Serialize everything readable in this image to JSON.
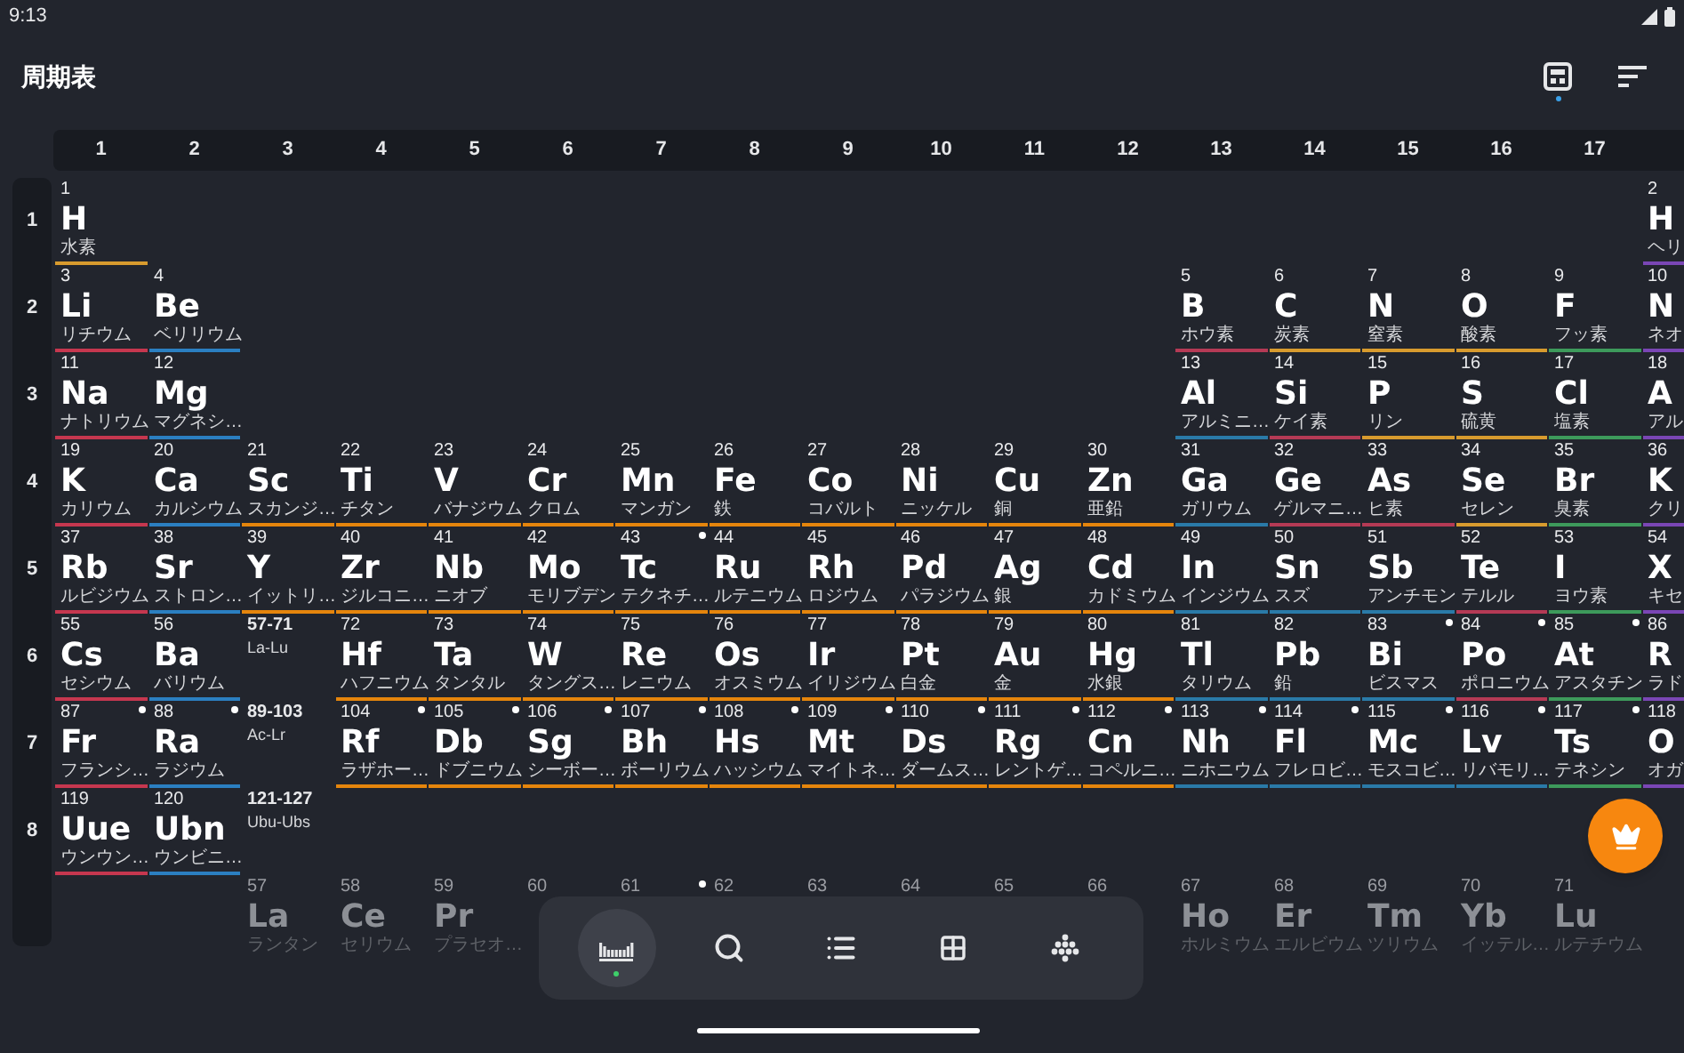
{
  "status_bar": {
    "time": "9:13"
  },
  "app_bar": {
    "title": "周期表",
    "actions": [
      {
        "badge": true
      },
      {
        "badge": false
      }
    ]
  },
  "group_header": [
    "1",
    "2",
    "3",
    "4",
    "5",
    "6",
    "7",
    "8",
    "9",
    "10",
    "11",
    "12",
    "13",
    "14",
    "15",
    "16",
    "17"
  ],
  "periods": [
    {
      "label": "1",
      "cells": [
        {
          "kind": "element",
          "number": "1",
          "symbol": "H",
          "name": "水素",
          "color": "#d89b2e",
          "radioactive": false
        },
        {
          "kind": "empty"
        },
        {
          "kind": "empty"
        },
        {
          "kind": "empty"
        },
        {
          "kind": "empty"
        },
        {
          "kind": "empty"
        },
        {
          "kind": "empty"
        },
        {
          "kind": "empty"
        },
        {
          "kind": "empty"
        },
        {
          "kind": "empty"
        },
        {
          "kind": "empty"
        },
        {
          "kind": "empty"
        },
        {
          "kind": "empty"
        },
        {
          "kind": "empty"
        },
        {
          "kind": "empty"
        },
        {
          "kind": "empty"
        },
        {
          "kind": "empty"
        },
        {
          "kind": "element",
          "number": "2",
          "symbol": "H",
          "name": "ヘリ",
          "color": "#7a46b5",
          "radioactive": false
        }
      ]
    },
    {
      "label": "2",
      "cells": [
        {
          "kind": "element",
          "number": "3",
          "symbol": "Li",
          "name": "リチウム",
          "color": "#c6374f",
          "radioactive": false
        },
        {
          "kind": "element",
          "number": "4",
          "symbol": "Be",
          "name": "ベリリウム",
          "color": "#2b7fc1",
          "radioactive": false
        },
        {
          "kind": "empty"
        },
        {
          "kind": "empty"
        },
        {
          "kind": "empty"
        },
        {
          "kind": "empty"
        },
        {
          "kind": "empty"
        },
        {
          "kind": "empty"
        },
        {
          "kind": "empty"
        },
        {
          "kind": "empty"
        },
        {
          "kind": "empty"
        },
        {
          "kind": "empty"
        },
        {
          "kind": "element",
          "number": "5",
          "symbol": "B",
          "name": "ホウ素",
          "color": "#b53a55",
          "radioactive": false
        },
        {
          "kind": "element",
          "number": "6",
          "symbol": "C",
          "name": "炭素",
          "color": "#d89b2e",
          "radioactive": false
        },
        {
          "kind": "element",
          "number": "7",
          "symbol": "N",
          "name": "窒素",
          "color": "#d89b2e",
          "radioactive": false
        },
        {
          "kind": "element",
          "number": "8",
          "symbol": "O",
          "name": "酸素",
          "color": "#d89b2e",
          "radioactive": false
        },
        {
          "kind": "element",
          "number": "9",
          "symbol": "F",
          "name": "フッ素",
          "color": "#3d9a5b",
          "radioactive": false
        },
        {
          "kind": "element",
          "number": "10",
          "symbol": "N",
          "name": "ネオ",
          "color": "#7a46b5",
          "radioactive": false
        }
      ]
    },
    {
      "label": "3",
      "cells": [
        {
          "kind": "element",
          "number": "11",
          "symbol": "Na",
          "name": "ナトリウム",
          "color": "#c6374f",
          "radioactive": false
        },
        {
          "kind": "element",
          "number": "12",
          "symbol": "Mg",
          "name": "マグネシ…",
          "color": "#2b7fc1",
          "radioactive": false
        },
        {
          "kind": "empty"
        },
        {
          "kind": "empty"
        },
        {
          "kind": "empty"
        },
        {
          "kind": "empty"
        },
        {
          "kind": "empty"
        },
        {
          "kind": "empty"
        },
        {
          "kind": "empty"
        },
        {
          "kind": "empty"
        },
        {
          "kind": "empty"
        },
        {
          "kind": "empty"
        },
        {
          "kind": "element",
          "number": "13",
          "symbol": "Al",
          "name": "アルミニ…",
          "color": "#2a7aa8",
          "radioactive": false
        },
        {
          "kind": "element",
          "number": "14",
          "symbol": "Si",
          "name": "ケイ素",
          "color": "#b53a55",
          "radioactive": false
        },
        {
          "kind": "element",
          "number": "15",
          "symbol": "P",
          "name": "リン",
          "color": "#d89b2e",
          "radioactive": false
        },
        {
          "kind": "element",
          "number": "16",
          "symbol": "S",
          "name": "硫黄",
          "color": "#d89b2e",
          "radioactive": false
        },
        {
          "kind": "element",
          "number": "17",
          "symbol": "Cl",
          "name": "塩素",
          "color": "#3d9a5b",
          "radioactive": false
        },
        {
          "kind": "element",
          "number": "18",
          "symbol": "A",
          "name": "アル",
          "color": "#7a46b5",
          "radioactive": false
        }
      ]
    },
    {
      "label": "4",
      "cells": [
        {
          "kind": "element",
          "number": "19",
          "symbol": "K",
          "name": "カリウム",
          "color": "#c6374f",
          "radioactive": false
        },
        {
          "kind": "element",
          "number": "20",
          "symbol": "Ca",
          "name": "カルシウム",
          "color": "#2b7fc1",
          "radioactive": false
        },
        {
          "kind": "element",
          "number": "21",
          "symbol": "Sc",
          "name": "スカンジ…",
          "color": "#e5850c",
          "radioactive": false
        },
        {
          "kind": "element",
          "number": "22",
          "symbol": "Ti",
          "name": "チタン",
          "color": "#e5850c",
          "radioactive": false
        },
        {
          "kind": "element",
          "number": "23",
          "symbol": "V",
          "name": "バナジウム",
          "color": "#e5850c",
          "radioactive": false
        },
        {
          "kind": "element",
          "number": "24",
          "symbol": "Cr",
          "name": "クロム",
          "color": "#e5850c",
          "radioactive": false
        },
        {
          "kind": "element",
          "number": "25",
          "symbol": "Mn",
          "name": "マンガン",
          "color": "#e5850c",
          "radioactive": false
        },
        {
          "kind": "element",
          "number": "26",
          "symbol": "Fe",
          "name": "鉄",
          "color": "#e5850c",
          "radioactive": false
        },
        {
          "kind": "element",
          "number": "27",
          "symbol": "Co",
          "name": "コバルト",
          "color": "#e5850c",
          "radioactive": false
        },
        {
          "kind": "element",
          "number": "28",
          "symbol": "Ni",
          "name": "ニッケル",
          "color": "#e5850c",
          "radioactive": false
        },
        {
          "kind": "element",
          "number": "29",
          "symbol": "Cu",
          "name": "銅",
          "color": "#e5850c",
          "radioactive": false
        },
        {
          "kind": "element",
          "number": "30",
          "symbol": "Zn",
          "name": "亜鉛",
          "color": "#e5850c",
          "radioactive": false
        },
        {
          "kind": "element",
          "number": "31",
          "symbol": "Ga",
          "name": "ガリウム",
          "color": "#2a7aa8",
          "radioactive": false
        },
        {
          "kind": "element",
          "number": "32",
          "symbol": "Ge",
          "name": "ゲルマニ…",
          "color": "#b53a55",
          "radioactive": false
        },
        {
          "kind": "element",
          "number": "33",
          "symbol": "As",
          "name": "ヒ素",
          "color": "#b53a55",
          "radioactive": false
        },
        {
          "kind": "element",
          "number": "34",
          "symbol": "Se",
          "name": "セレン",
          "color": "#d89b2e",
          "radioactive": false
        },
        {
          "kind": "element",
          "number": "35",
          "symbol": "Br",
          "name": "臭素",
          "color": "#3d9a5b",
          "radioactive": false
        },
        {
          "kind": "element",
          "number": "36",
          "symbol": "K",
          "name": "クリ",
          "color": "#7a46b5",
          "radioactive": false
        }
      ]
    },
    {
      "label": "5",
      "cells": [
        {
          "kind": "element",
          "number": "37",
          "symbol": "Rb",
          "name": "ルビジウム",
          "color": "#c6374f",
          "radioactive": false
        },
        {
          "kind": "element",
          "number": "38",
          "symbol": "Sr",
          "name": "ストロン…",
          "color": "#2b7fc1",
          "radioactive": false
        },
        {
          "kind": "element",
          "number": "39",
          "symbol": "Y",
          "name": "イットリ…",
          "color": "#e5850c",
          "radioactive": false
        },
        {
          "kind": "element",
          "number": "40",
          "symbol": "Zr",
          "name": "ジルコニ…",
          "color": "#e5850c",
          "radioactive": false
        },
        {
          "kind": "element",
          "number": "41",
          "symbol": "Nb",
          "name": "ニオブ",
          "color": "#e5850c",
          "radioactive": false
        },
        {
          "kind": "element",
          "number": "42",
          "symbol": "Mo",
          "name": "モリブデン",
          "color": "#e5850c",
          "radioactive": false
        },
        {
          "kind": "element",
          "number": "43",
          "symbol": "Tc",
          "name": "テクネチ…",
          "color": "#e5850c",
          "radioactive": true
        },
        {
          "kind": "element",
          "number": "44",
          "symbol": "Ru",
          "name": "ルテニウム",
          "color": "#e5850c",
          "radioactive": false
        },
        {
          "kind": "element",
          "number": "45",
          "symbol": "Rh",
          "name": "ロジウム",
          "color": "#e5850c",
          "radioactive": false
        },
        {
          "kind": "element",
          "number": "46",
          "symbol": "Pd",
          "name": "パラジウム",
          "color": "#e5850c",
          "radioactive": false
        },
        {
          "kind": "element",
          "number": "47",
          "symbol": "Ag",
          "name": "銀",
          "color": "#e5850c",
          "radioactive": false
        },
        {
          "kind": "element",
          "number": "48",
          "symbol": "Cd",
          "name": "カドミウム",
          "color": "#e5850c",
          "radioactive": false
        },
        {
          "kind": "element",
          "number": "49",
          "symbol": "In",
          "name": "インジウム",
          "color": "#2a7aa8",
          "radioactive": false
        },
        {
          "kind": "element",
          "number": "50",
          "symbol": "Sn",
          "name": "スズ",
          "color": "#2a7aa8",
          "radioactive": false
        },
        {
          "kind": "element",
          "number": "51",
          "symbol": "Sb",
          "name": "アンチモン",
          "color": "#2a7aa8",
          "radioactive": false
        },
        {
          "kind": "element",
          "number": "52",
          "symbol": "Te",
          "name": "テルル",
          "color": "#b53a55",
          "radioactive": false
        },
        {
          "kind": "element",
          "number": "53",
          "symbol": "I",
          "name": "ヨウ素",
          "color": "#3d9a5b",
          "radioactive": false
        },
        {
          "kind": "element",
          "number": "54",
          "symbol": "X",
          "name": "キセ",
          "color": "#7a46b5",
          "radioactive": false
        }
      ]
    },
    {
      "label": "6",
      "cells": [
        {
          "kind": "element",
          "number": "55",
          "symbol": "Cs",
          "name": "セシウム",
          "color": "#c6374f",
          "radioactive": false
        },
        {
          "kind": "element",
          "number": "56",
          "symbol": "Ba",
          "name": "バリウム",
          "color": "#2b7fc1",
          "radioactive": false
        },
        {
          "kind": "range",
          "numbers": "57-71",
          "symbols": "La-Lu"
        },
        {
          "kind": "element",
          "number": "72",
          "symbol": "Hf",
          "name": "ハフニウム",
          "color": "#e5850c",
          "radioactive": false
        },
        {
          "kind": "element",
          "number": "73",
          "symbol": "Ta",
          "name": "タンタル",
          "color": "#e5850c",
          "radioactive": false
        },
        {
          "kind": "element",
          "number": "74",
          "symbol": "W",
          "name": "タングス…",
          "color": "#e5850c",
          "radioactive": false
        },
        {
          "kind": "element",
          "number": "75",
          "symbol": "Re",
          "name": "レニウム",
          "color": "#e5850c",
          "radioactive": false
        },
        {
          "kind": "element",
          "number": "76",
          "symbol": "Os",
          "name": "オスミウム",
          "color": "#e5850c",
          "radioactive": false
        },
        {
          "kind": "element",
          "number": "77",
          "symbol": "Ir",
          "name": "イリジウム",
          "color": "#e5850c",
          "radioactive": false
        },
        {
          "kind": "element",
          "number": "78",
          "symbol": "Pt",
          "name": "白金",
          "color": "#e5850c",
          "radioactive": false
        },
        {
          "kind": "element",
          "number": "79",
          "symbol": "Au",
          "name": "金",
          "color": "#e5850c",
          "radioactive": false
        },
        {
          "kind": "element",
          "number": "80",
          "symbol": "Hg",
          "name": "水銀",
          "color": "#e5850c",
          "radioactive": false
        },
        {
          "kind": "element",
          "number": "81",
          "symbol": "Tl",
          "name": "タリウム",
          "color": "#2a7aa8",
          "radioactive": false
        },
        {
          "kind": "element",
          "number": "82",
          "symbol": "Pb",
          "name": "鉛",
          "color": "#2a7aa8",
          "radioactive": false
        },
        {
          "kind": "element",
          "number": "83",
          "symbol": "Bi",
          "name": "ビスマス",
          "color": "#2a7aa8",
          "radioactive": true
        },
        {
          "kind": "element",
          "number": "84",
          "symbol": "Po",
          "name": "ポロニウム",
          "color": "#b53a55",
          "radioactive": true
        },
        {
          "kind": "element",
          "number": "85",
          "symbol": "At",
          "name": "アスタチン",
          "color": "#3d9a5b",
          "radioactive": true
        },
        {
          "kind": "element",
          "number": "86",
          "symbol": "R",
          "name": "ラド",
          "color": "#7a46b5",
          "radioactive": false
        }
      ]
    },
    {
      "label": "7",
      "cells": [
        {
          "kind": "element",
          "number": "87",
          "symbol": "Fr",
          "name": "フランシ…",
          "color": "#c6374f",
          "radioactive": true
        },
        {
          "kind": "element",
          "number": "88",
          "symbol": "Ra",
          "name": "ラジウム",
          "color": "#2b7fc1",
          "radioactive": true
        },
        {
          "kind": "range",
          "numbers": "89-103",
          "symbols": "Ac-Lr"
        },
        {
          "kind": "element",
          "number": "104",
          "symbol": "Rf",
          "name": "ラザホー…",
          "color": "#e5850c",
          "radioactive": true
        },
        {
          "kind": "element",
          "number": "105",
          "symbol": "Db",
          "name": "ドブニウム",
          "color": "#e5850c",
          "radioactive": true
        },
        {
          "kind": "element",
          "number": "106",
          "symbol": "Sg",
          "name": "シーボー…",
          "color": "#e5850c",
          "radioactive": true
        },
        {
          "kind": "element",
          "number": "107",
          "symbol": "Bh",
          "name": "ボーリウム",
          "color": "#e5850c",
          "radioactive": true
        },
        {
          "kind": "element",
          "number": "108",
          "symbol": "Hs",
          "name": "ハッシウム",
          "color": "#e5850c",
          "radioactive": true
        },
        {
          "kind": "element",
          "number": "109",
          "symbol": "Mt",
          "name": "マイトネ…",
          "color": "#e5850c",
          "radioactive": true
        },
        {
          "kind": "element",
          "number": "110",
          "symbol": "Ds",
          "name": "ダームス…",
          "color": "#e5850c",
          "radioactive": true
        },
        {
          "kind": "element",
          "number": "111",
          "symbol": "Rg",
          "name": "レントゲ…",
          "color": "#e5850c",
          "radioactive": true
        },
        {
          "kind": "element",
          "number": "112",
          "symbol": "Cn",
          "name": "コペルニ…",
          "color": "#e5850c",
          "radioactive": true
        },
        {
          "kind": "element",
          "number": "113",
          "symbol": "Nh",
          "name": "ニホニウム",
          "color": "#2a7aa8",
          "radioactive": true
        },
        {
          "kind": "element",
          "number": "114",
          "symbol": "Fl",
          "name": "フレロビ…",
          "color": "#2a7aa8",
          "radioactive": true
        },
        {
          "kind": "element",
          "number": "115",
          "symbol": "Mc",
          "name": "モスコビ…",
          "color": "#2a7aa8",
          "radioactive": true
        },
        {
          "kind": "element",
          "number": "116",
          "symbol": "Lv",
          "name": "リバモリ…",
          "color": "#2a7aa8",
          "radioactive": true
        },
        {
          "kind": "element",
          "number": "117",
          "symbol": "Ts",
          "name": "テネシン",
          "color": "#3d9a5b",
          "radioactive": true
        },
        {
          "kind": "element",
          "number": "118",
          "symbol": "O",
          "name": "オガ",
          "color": "#7a46b5",
          "radioactive": false
        }
      ]
    },
    {
      "label": "8",
      "cells": [
        {
          "kind": "element",
          "number": "119",
          "symbol": "Uue",
          "name": "ウンウン…",
          "color": "#c6374f",
          "radioactive": false
        },
        {
          "kind": "element",
          "number": "120",
          "symbol": "Ubn",
          "name": "ウンビニ…",
          "color": "#2b7fc1",
          "radioactive": false
        },
        {
          "kind": "range",
          "numbers": "121-127",
          "symbols": "Ubu-Ubs"
        }
      ]
    }
  ],
  "f_block": {
    "cells": [
      {
        "kind": "empty"
      },
      {
        "kind": "empty"
      },
      {
        "kind": "element",
        "number": "57",
        "symbol": "La",
        "name": "ランタン",
        "radioactive": false
      },
      {
        "kind": "element",
        "number": "58",
        "symbol": "Ce",
        "name": "セリウム",
        "radioactive": false
      },
      {
        "kind": "element",
        "number": "59",
        "symbol": "Pr",
        "name": "プラセオ…",
        "radioactive": false
      },
      {
        "kind": "element",
        "number": "60",
        "radioactive": false
      },
      {
        "kind": "element",
        "number": "61",
        "radioactive": true
      },
      {
        "kind": "element",
        "number": "62",
        "radioactive": false
      },
      {
        "kind": "element",
        "number": "63",
        "radioactive": false
      },
      {
        "kind": "element",
        "number": "64",
        "radioactive": false
      },
      {
        "kind": "element",
        "number": "65",
        "radioactive": false
      },
      {
        "kind": "element",
        "number": "66",
        "radioactive": false
      },
      {
        "kind": "element",
        "number": "67",
        "symbol": "Ho",
        "name": "ホルミウム",
        "radioactive": false
      },
      {
        "kind": "element",
        "number": "68",
        "symbol": "Er",
        "name": "エルビウム",
        "radioactive": false
      },
      {
        "kind": "element",
        "number": "69",
        "symbol": "Tm",
        "name": "ツリウム",
        "radioactive": false
      },
      {
        "kind": "element",
        "number": "70",
        "symbol": "Yb",
        "name": "イッテル…",
        "radioactive": false
      },
      {
        "kind": "element",
        "number": "71",
        "symbol": "Lu",
        "name": "ルテチウム",
        "radioactive": false
      }
    ]
  },
  "bottom_nav": [
    {
      "selected": true
    },
    {
      "selected": false
    },
    {
      "selected": false
    },
    {
      "selected": false
    },
    {
      "selected": false
    }
  ]
}
